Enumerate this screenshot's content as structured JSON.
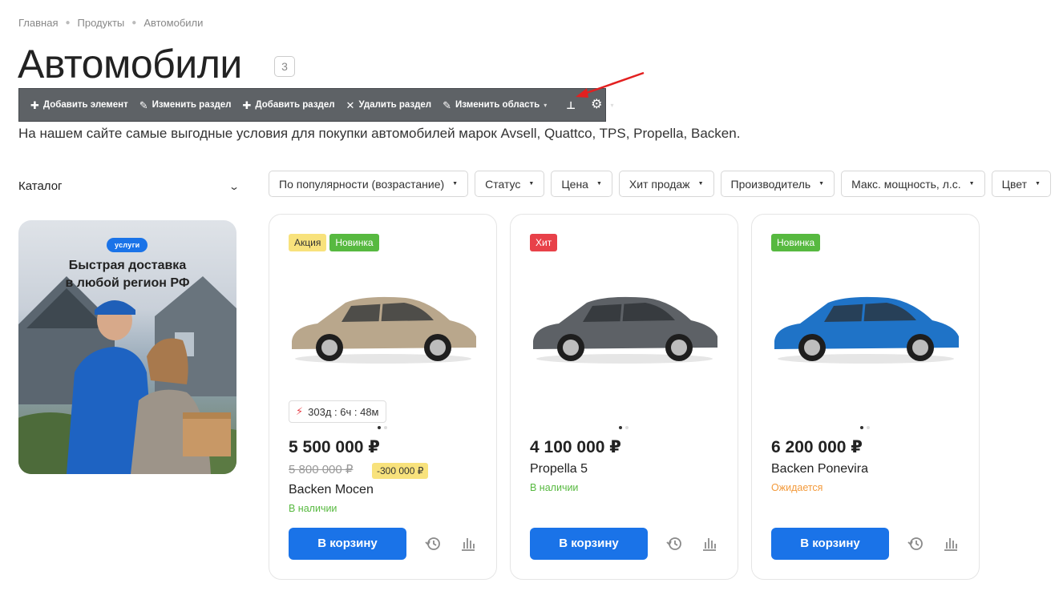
{
  "breadcrumb": [
    "Главная",
    "Продукты",
    "Автомобили"
  ],
  "page": {
    "title": "Автомобили",
    "count": "3",
    "description": "На нашем сайте самые выгодные условия для покупки автомобилей марок Avsell, Quattco, TPS, Propella, Backen."
  },
  "admin_toolbar": {
    "add_element": "Добавить элемент",
    "edit_section": "Изменить раздел",
    "add_section": "Добавить раздел",
    "delete_section": "Удалить раздел",
    "edit_area": "Изменить область"
  },
  "sidebar": {
    "catalog_label": "Каталог",
    "promo": {
      "pill": "услуги",
      "title_line1": "Быстрая доставка",
      "title_line2": "в любой регион РФ"
    }
  },
  "filters": [
    "По популярности (возрастание)",
    "Статус",
    "Цена",
    "Хит продаж",
    "Производитель",
    "Макс. мощность, л.с.",
    "Цвет"
  ],
  "products": [
    {
      "badges": [
        "Акция",
        "Новинка"
      ],
      "timer": "303д : 6ч : 48м",
      "price": "5 500 000 ₽",
      "old_price": "5 800 000 ₽",
      "discount": "-300 000 ₽",
      "name": "Backen Mocen",
      "stock": "В наличии",
      "cart": "В корзину",
      "car_color": "#b9a78c"
    },
    {
      "badges": [
        "Хит"
      ],
      "price": "4 100 000 ₽",
      "name": "Propella 5",
      "stock": "В наличии",
      "cart": "В корзину",
      "car_color": "#5d6166"
    },
    {
      "badges": [
        "Новинка"
      ],
      "price": "6 200 000 ₽",
      "name": "Backen Ponevira",
      "stock": "Ожидается",
      "cart": "В корзину",
      "car_color": "#1f73c7"
    }
  ],
  "colors": {
    "accent": "#1a73e8",
    "in_stock": "#57b940",
    "expected": "#f39a3b",
    "badge_sale": "#f8e27c",
    "badge_new": "#57b940",
    "badge_hit": "#e84149"
  }
}
